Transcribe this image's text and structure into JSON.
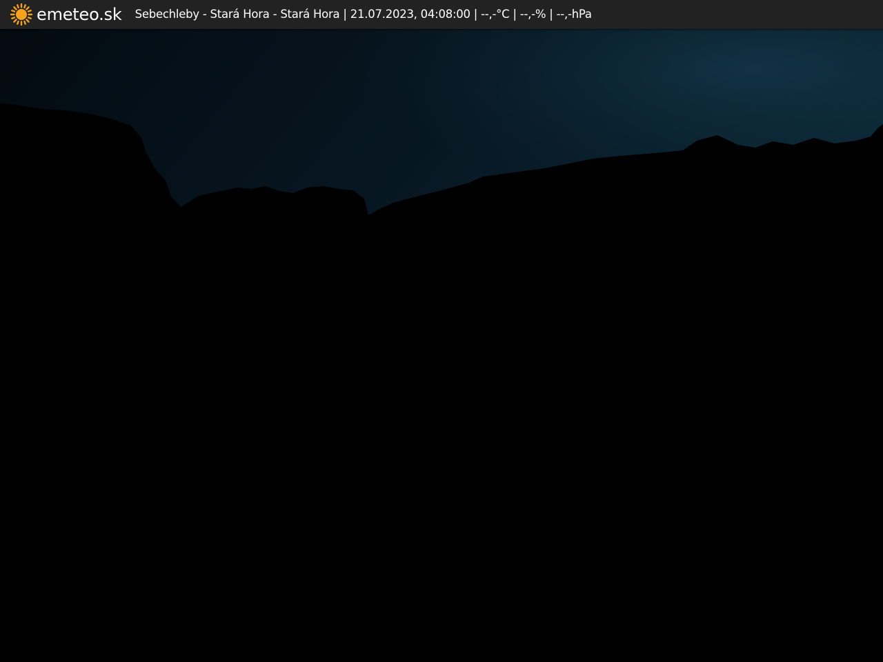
{
  "header": {
    "brand": "emeteo.sk",
    "logo_icon": "sun-icon",
    "info_text": "Sebechleby - Stará Hora - Stará Hora | 21.07.2023, 04:08:00 | --,-°C | --,-% | --,-hPa"
  },
  "colors": {
    "top_bar_background": "#222222",
    "sun_orange": "#f6a21b",
    "text": "#ffffff",
    "sky": "#0c2433",
    "ground": "#000000"
  }
}
